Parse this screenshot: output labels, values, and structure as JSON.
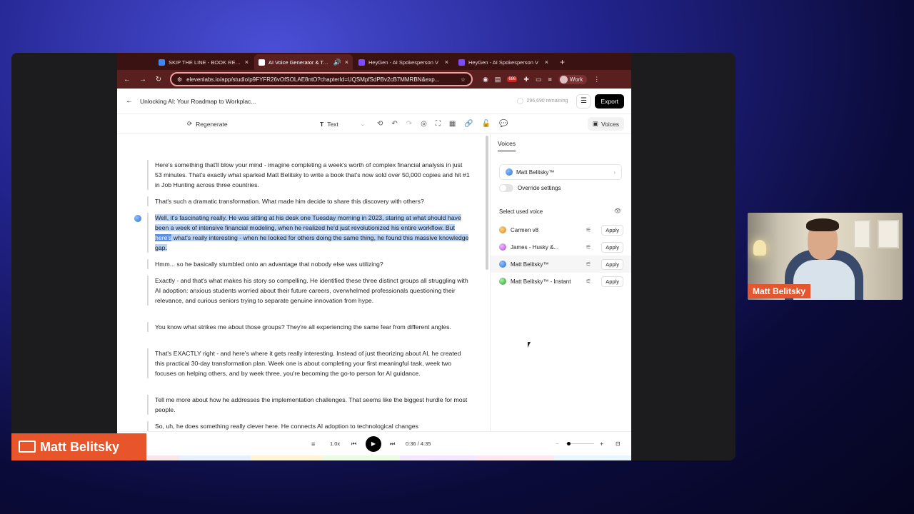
{
  "browser": {
    "tabs": [
      {
        "title": "SKIP THE LINE - BOOK REVIE",
        "color": "#4285f4",
        "active": false
      },
      {
        "title": "AI Voice Generator & Text",
        "color": "#ffffff",
        "active": true
      },
      {
        "title": "HeyGen - AI Spokesperson V",
        "color": "#7c4dff",
        "active": false
      },
      {
        "title": "HeyGen - AI Spokesperson V",
        "color": "#7c4dff",
        "active": false
      }
    ],
    "url": "elevenlabs.io/app/studio/p9FYFR26vOfSOLAE8ntO?chapterId=UQSMpfSdPBv2cB7MMRBN&exp...",
    "ext_badge": "686",
    "profile": "Work"
  },
  "app": {
    "title": "Unlocking AI: Your Roadmap to Workplac...",
    "remaining": "296,690 remaining",
    "export_label": "Export",
    "toolbar": {
      "regenerate": "Regenerate",
      "text_mode": "Text",
      "voices": "Voices"
    }
  },
  "script": [
    {
      "text": "Here's something that'll blow your mind - imagine completing a week's worth of complex financial analysis in just 53 minutes. That's exactly what sparked Matt Belitsky to write a book that's now sold over 50,000 copies and hit #1 in Job Hunting across three countries."
    },
    {
      "text": "That's such a dramatic transformation. What made him decide to share this discovery with others?"
    },
    {
      "pre": "Well, it's fascinating really. He was sitting at his desk one Tuesday morning in 2023, staring at what should have been a week of intensive financial modeling, when he realized he'd just revolutionized his entire workflow. But ",
      "highlight": "here's",
      "post": " what's really interesting - when he looked for others doing the same thing, he found this massive knowledge gap."
    },
    {
      "text": "Hmm... so he basically stumbled onto an advantage that nobody else was utilizing?"
    },
    {
      "text": "Exactly - and that's what makes his story so compelling. He identified these three distinct groups all struggling with AI adoption: anxious students worried about their future careers, overwhelmed professionals questioning their relevance, and curious seniors trying to separate genuine innovation from hype."
    },
    {
      "text": "You know what strikes me about those groups? They're all experiencing the same fear from different angles."
    },
    {
      "text": "That's EXACTLY right - and here's where it gets really interesting. Instead of just theorizing about AI, he created this practical 30-day transformation plan. Week one is about completing your first meaningful task, week two focuses on helping others, and by week three, you're becoming the go-to person for AI guidance."
    },
    {
      "text": "Tell me more about how he addresses the implementation challenges. That seems like the biggest hurdle for most people."
    },
    {
      "text": "So, uh, he does something really clever here. He connects AI adoption to technological changes"
    }
  ],
  "sidebar": {
    "header": "Voices",
    "current_voice": "Matt Belitsky™",
    "override_label": "Override settings",
    "select_label": "Select used voice",
    "voices": [
      {
        "name": "Carmen v8",
        "color": "#e8a43a",
        "apply": "Apply"
      },
      {
        "name": "James - Husky &...",
        "color": "#c86fe0",
        "apply": "Apply"
      },
      {
        "name": "Matt Belitsky™",
        "color": "#3a7fd6",
        "apply": "Apply"
      },
      {
        "name": "Matt Belitsky™ - Instant",
        "color": "#3cb44a",
        "apply": "Apply"
      }
    ]
  },
  "player": {
    "speed": "1.0x",
    "time": "0:36 / 4:35"
  },
  "presenter": {
    "cam_name": "Matt Belitsky",
    "lower_third": "Matt Belitsky"
  }
}
